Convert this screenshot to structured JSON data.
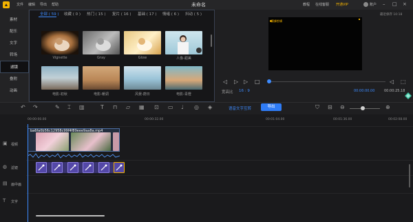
{
  "titlebar": {
    "menu": [
      "文件",
      "编辑",
      "导出",
      "帮助"
    ],
    "doc_title": "未命名",
    "links": [
      "教程",
      "在线客服"
    ],
    "vip": "开通VIP",
    "user": "账户"
  },
  "sidebar": {
    "items": [
      {
        "label": "素材"
      },
      {
        "label": "配乐"
      },
      {
        "label": "文字"
      },
      {
        "label": "转场"
      },
      {
        "label": "滤镜",
        "active": true
      },
      {
        "label": "叠附"
      },
      {
        "label": "动画"
      }
    ]
  },
  "filter_tabs": [
    "全部 ( 59 )",
    "收藏 ( 0 )",
    "热门 ( 15 )",
    "复片 ( 16 )",
    "基础 ( 17 )",
    "情绪 ( 6 )",
    "抖动 ( 5 )"
  ],
  "filters": [
    {
      "label": "Vignette"
    },
    {
      "label": "Gray"
    },
    {
      "label": "Glow"
    },
    {
      "label": "人像-甜美"
    },
    {
      "label": "电影-初秋"
    },
    {
      "label": "电影-暖调"
    },
    {
      "label": "风景-蔚日"
    },
    {
      "label": "电影-青橙"
    }
  ],
  "preview": {
    "autosave": "最近保存 10:18",
    "watermark": "蜜蜂剪辑",
    "ratio_label": "宽高比",
    "ratio_value": "16 : 9",
    "time_current": "00:00:00.00",
    "time_total": "00:00:25.18"
  },
  "toolbar": {
    "speech_to_text": "语音文字互转",
    "export": "导出"
  },
  "timeline": {
    "ticks": [
      "00:00:00.00",
      "00:00:32.00",
      "00:01:04.00",
      "00:01:36.00",
      "00:02:08.00"
    ],
    "tracks": [
      "视频",
      "滤镜",
      "画中画",
      "文字"
    ],
    "clip_name": "ba6fa0b56c12958c99f4f89eee9aa8a.mp4"
  },
  "colors": {
    "accent": "#3d8bff",
    "vip": "#f5b400",
    "fx_clip": "#5448a8"
  }
}
